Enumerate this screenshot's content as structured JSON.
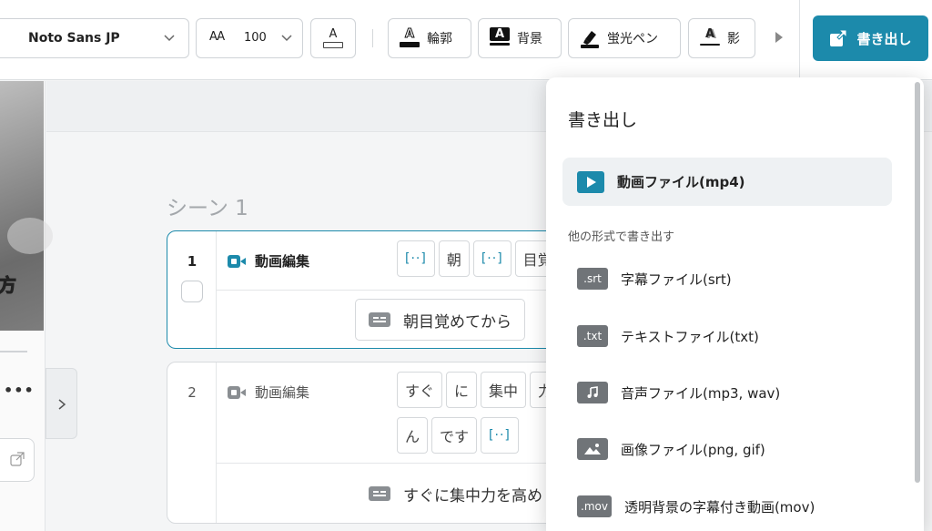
{
  "toolbar": {
    "font_name": "Noto Sans JP",
    "size_icon": "AA",
    "font_size": "100",
    "color_glyph": "A",
    "outline_label": "輪郭",
    "background_label": "背景",
    "marker_label": "蛍光ペン",
    "shadow_label": "影",
    "style_glyph": "A",
    "export_label": "書き出し"
  },
  "left_panel": {
    "preview_caption": "方",
    "more_dots": "•••"
  },
  "scene": {
    "title": "シーン 1",
    "cards": [
      {
        "index": "1",
        "label": "動画編集",
        "chips": [
          "[··]",
          "朝",
          "[··]",
          "目覚"
        ],
        "subtitle": "朝目覚めてから"
      },
      {
        "index": "2",
        "label": "動画編集",
        "chips_row1": [
          "すぐ",
          "に",
          "集中",
          "力"
        ],
        "chips_row2": [
          "ん",
          "です",
          "[··]"
        ],
        "subtitle": "すぐに集中力を高め"
      }
    ]
  },
  "export_menu": {
    "title": "書き出し",
    "primary": "動画ファイル(mp4)",
    "section_label": "他の形式で書き出す",
    "items": [
      {
        "badge": ".srt",
        "label": "字幕ファイル(srt)"
      },
      {
        "badge": ".txt",
        "label": "テキストファイル(txt)"
      },
      {
        "badge_icon": "music-note-icon",
        "label": "音声ファイル(mp3, wav)"
      },
      {
        "badge_icon": "image-icon",
        "label": "画像ファイル(png, gif)"
      },
      {
        "badge": ".mov",
        "label": "透明背景の字幕付き動画(mov)"
      }
    ]
  },
  "colors": {
    "accent": "#1c8aab",
    "badge": "#707478"
  }
}
